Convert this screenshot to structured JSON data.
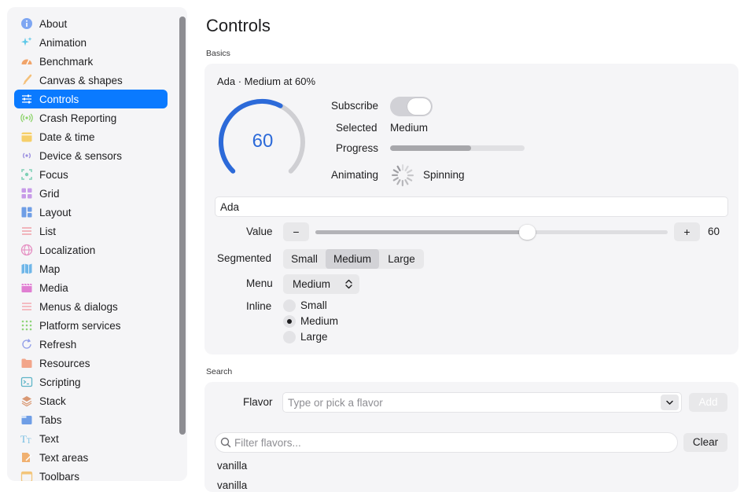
{
  "sidebar": {
    "items": [
      {
        "label": "About",
        "icon": "info-icon",
        "color": "#7ea6f2"
      },
      {
        "label": "Animation",
        "icon": "sparkles-icon",
        "color": "#5ec8e8"
      },
      {
        "label": "Benchmark",
        "icon": "gauge-icon",
        "color": "#f0a46a"
      },
      {
        "label": "Canvas & shapes",
        "icon": "brush-icon",
        "color": "#f4c07a"
      },
      {
        "label": "Controls",
        "icon": "sliders-icon",
        "color": "#ffffff"
      },
      {
        "label": "Crash Reporting",
        "icon": "broadcast-icon",
        "color": "#8dd36b"
      },
      {
        "label": "Date & time",
        "icon": "calendar-icon",
        "color": "#f6cf6a"
      },
      {
        "label": "Device & sensors",
        "icon": "sensor-icon",
        "color": "#9b8fe0"
      },
      {
        "label": "Focus",
        "icon": "focus-icon",
        "color": "#7fd0b6"
      },
      {
        "label": "Grid",
        "icon": "grid-icon",
        "color": "#c79be8"
      },
      {
        "label": "Layout",
        "icon": "layout-icon",
        "color": "#6f9ee6"
      },
      {
        "label": "List",
        "icon": "list-icon",
        "color": "#f0a0a8"
      },
      {
        "label": "Localization",
        "icon": "globe-icon",
        "color": "#e58fc2"
      },
      {
        "label": "Map",
        "icon": "map-icon",
        "color": "#6fb6e8"
      },
      {
        "label": "Media",
        "icon": "film-icon",
        "color": "#e07fd2"
      },
      {
        "label": "Menus & dialogs",
        "icon": "menu-lines-icon",
        "color": "#f39aa3"
      },
      {
        "label": "Platform services",
        "icon": "dots-grid-icon",
        "color": "#8fd47a"
      },
      {
        "label": "Refresh",
        "icon": "refresh-icon",
        "color": "#8e9be8"
      },
      {
        "label": "Resources",
        "icon": "folder-icon",
        "color": "#f2a58a"
      },
      {
        "label": "Scripting",
        "icon": "terminal-icon",
        "color": "#5fb5c7"
      },
      {
        "label": "Stack",
        "icon": "stack-icon",
        "color": "#d99873"
      },
      {
        "label": "Tabs",
        "icon": "tabs-icon",
        "color": "#6f9ee6"
      },
      {
        "label": "Text",
        "icon": "text-icon",
        "color": "#6fbbe0"
      },
      {
        "label": "Text areas",
        "icon": "edit-icon",
        "color": "#f0b070"
      },
      {
        "label": "Toolbars",
        "icon": "toolbar-icon",
        "color": "#f3c57a"
      }
    ],
    "active_index": 4,
    "accent": "#0a7aff"
  },
  "page": {
    "title": "Controls"
  },
  "basics": {
    "section_label": "Basics",
    "summary": "Ada · Medium at 60%",
    "gauge_value": "60",
    "gauge_fraction": 0.6,
    "gauge_color": "#2c6ad9",
    "subscribe_label": "Subscribe",
    "subscribe_on": false,
    "selected_label": "Selected",
    "selected_value": "Medium",
    "progress_label": "Progress",
    "progress_fraction": 0.6,
    "animating_label": "Animating",
    "animating_value": "Spinning",
    "name_value": "Ada",
    "value_label": "Value",
    "decrement": "−",
    "increment": "+",
    "value_number": "60",
    "slider_fraction": 0.6,
    "segmented_label": "Segmented",
    "segments": [
      "Small",
      "Medium",
      "Large"
    ],
    "segment_selected": 1,
    "menu_label": "Menu",
    "menu_value": "Medium",
    "inline_label": "Inline",
    "inline_options": [
      "Small",
      "Medium",
      "Large"
    ],
    "inline_selected": 1
  },
  "search": {
    "section_label": "Search",
    "flavor_label": "Flavor",
    "flavor_placeholder": "Type or pick a flavor",
    "add_label": "Add",
    "filter_placeholder": "Filter flavors...",
    "clear_label": "Clear",
    "results": [
      "vanilla",
      "vanilla"
    ]
  }
}
